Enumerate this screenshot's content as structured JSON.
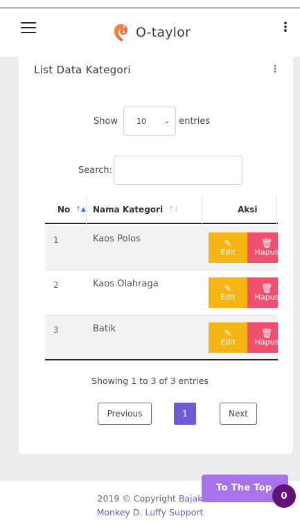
{
  "app": {
    "brand": "O-taylor"
  },
  "card": {
    "title": "List Data Kategori"
  },
  "length": {
    "show_label": "Show",
    "value": "10",
    "entries_label": "entries"
  },
  "search": {
    "label": "Search:",
    "value": ""
  },
  "table": {
    "columns": [
      "No",
      "Nama Kategori",
      "Aksi"
    ],
    "rows": [
      {
        "no": "1",
        "nama": "Kaos Polos",
        "edit": "Edit",
        "hapus": "Hapus"
      },
      {
        "no": "2",
        "nama": "Kaos Olahraga",
        "edit": "Edit",
        "hapus": "Hapus"
      },
      {
        "no": "3",
        "nama": "Batik",
        "edit": "Edit",
        "hapus": "Hapus"
      }
    ]
  },
  "info": "Showing 1 to 3 of 3 entries",
  "pagination": {
    "previous": "Previous",
    "current": "1",
    "next": "Next"
  },
  "footer": {
    "copyright": "2019 © Copyright",
    "link1": "Bajak",
    "link2": "Monkey D. Luffy",
    "link3": "Support"
  },
  "to_top": {
    "label": "To The Top",
    "badge": "0"
  },
  "colors": {
    "accent": "#6c5bd4",
    "edit": "#f6b512",
    "hapus": "#f0506e",
    "to_top": "#a872ea",
    "badge": "#62107a"
  },
  "icons": {
    "menu": "hamburger-icon",
    "more": "kebab-icon",
    "edit": "edit-icon",
    "delete": "trash-icon"
  }
}
